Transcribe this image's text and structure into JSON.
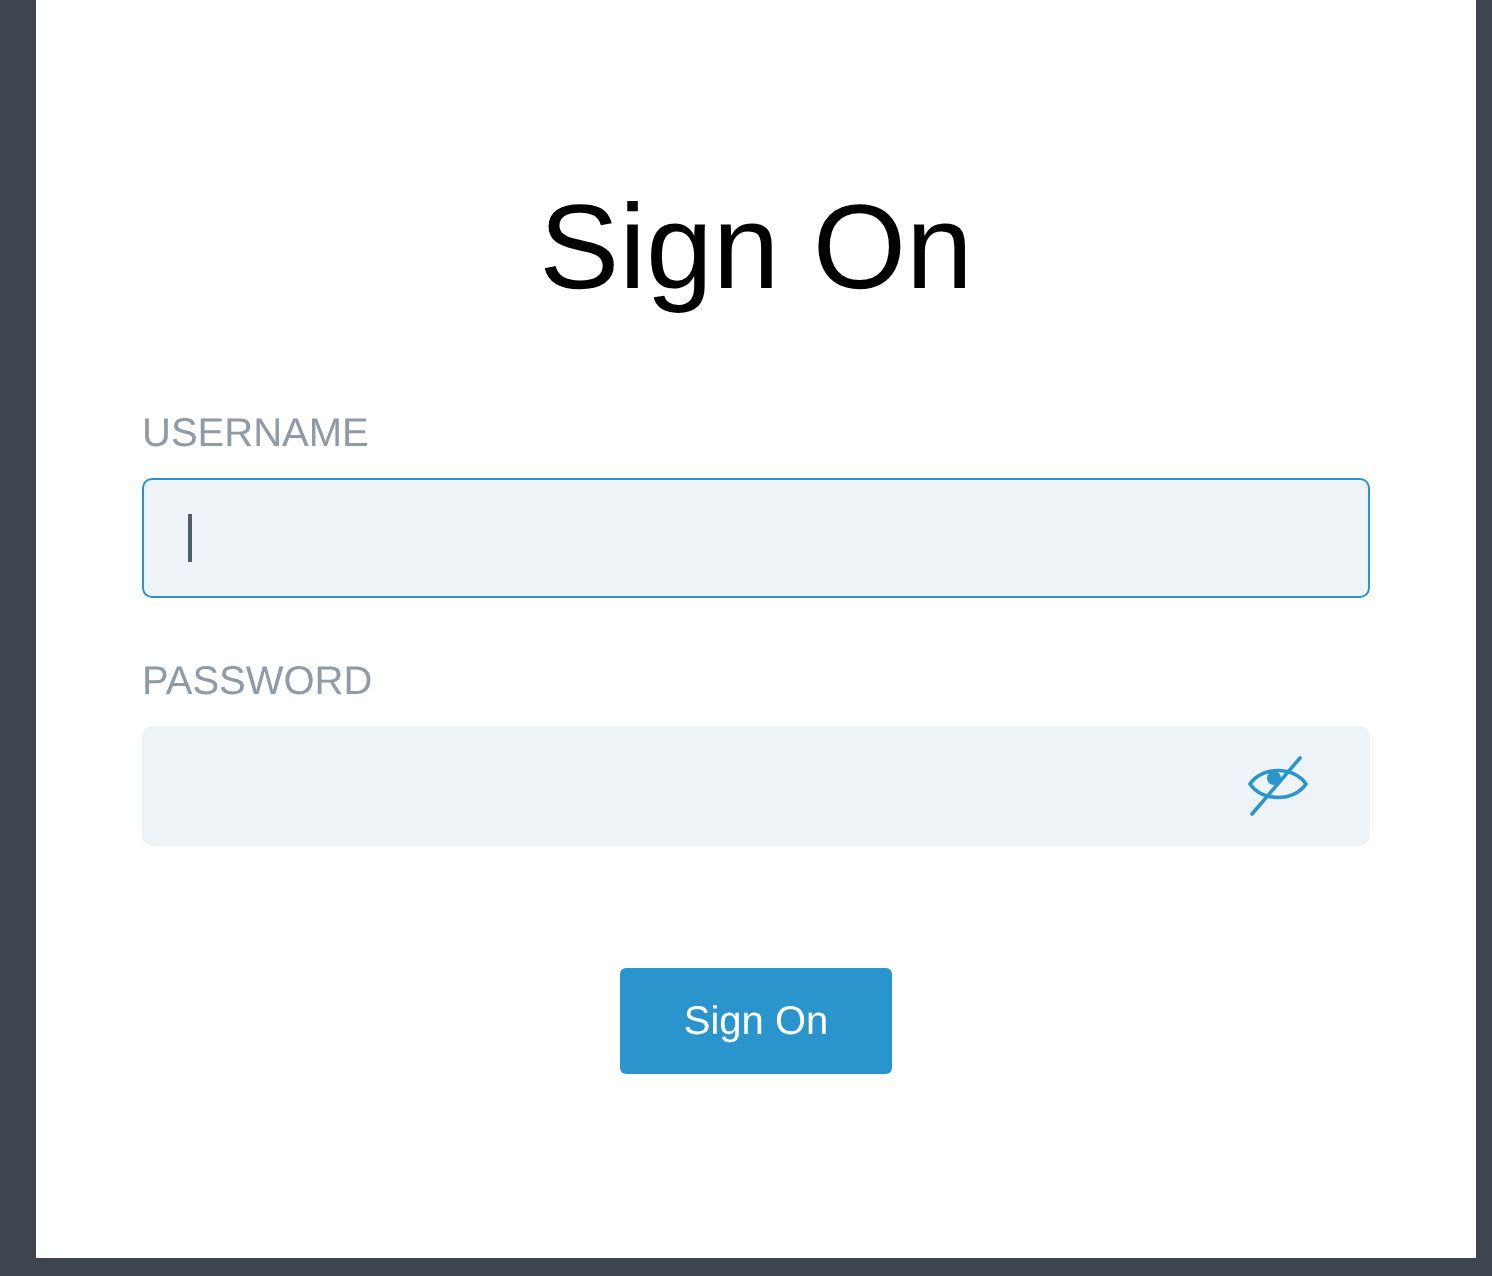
{
  "title": "Sign On",
  "fields": [
    {
      "label": "USERNAME",
      "kind": "text",
      "focused": true
    },
    {
      "label": "PASSWORD",
      "kind": "password",
      "focused": false
    }
  ],
  "button": "Sign On"
}
